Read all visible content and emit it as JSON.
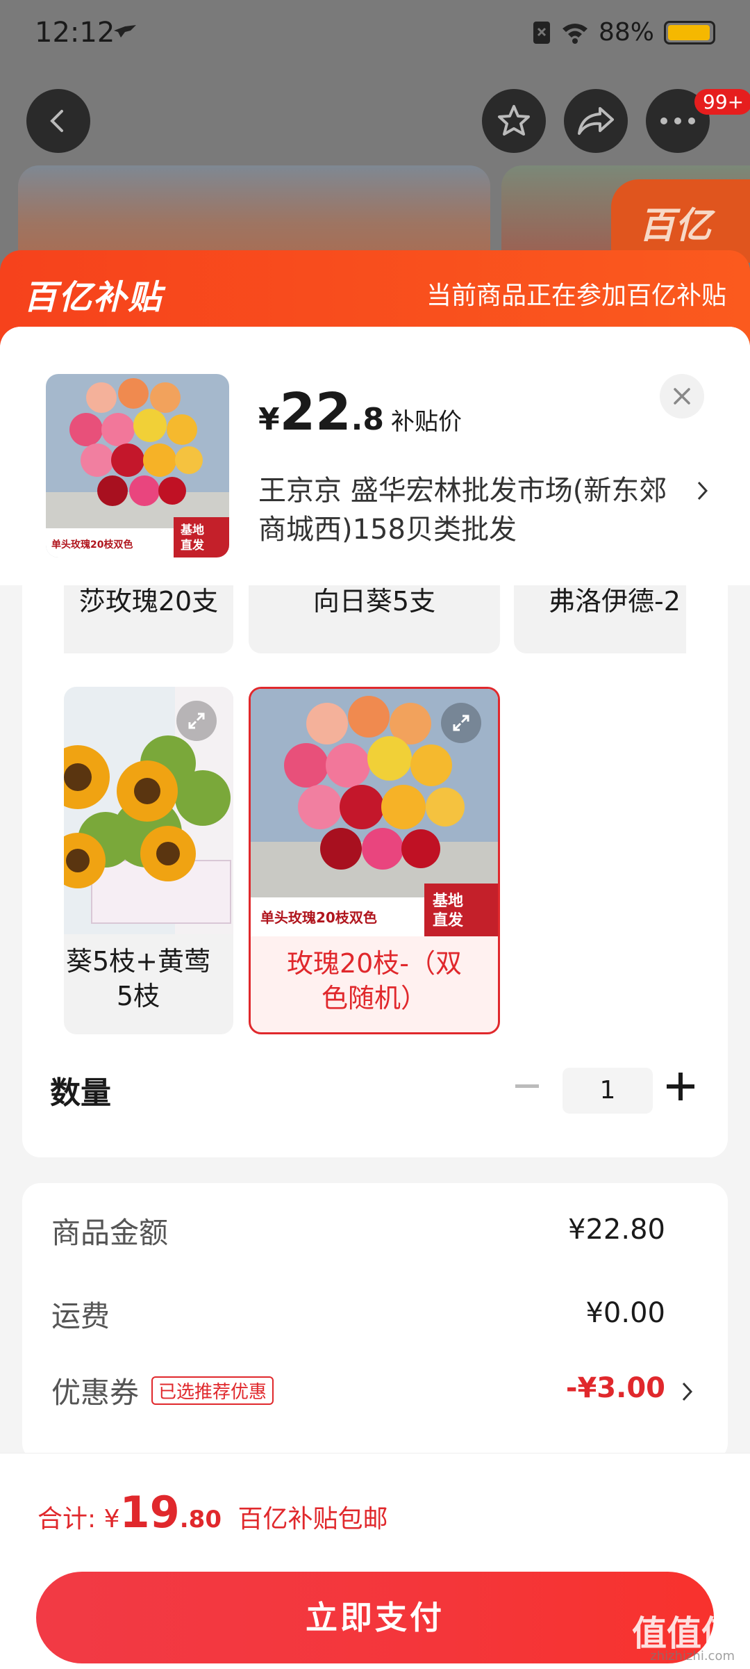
{
  "status_bar": {
    "time": "12:12",
    "battery": "88%"
  },
  "top_bar": {
    "badge": "99+"
  },
  "background_badge": "百亿",
  "banner": {
    "logo": "百亿补贴",
    "text": "当前商品正在参加百亿补贴"
  },
  "product": {
    "currency": "¥",
    "price_int": "22",
    "price_dec": ".8",
    "price_label": "补贴价",
    "shop": "王京京  盛华宏林批发市场(新东郊商城西)158贝类批发",
    "thumb_text_1": "单头玫瑰20枝双色",
    "thumb_text_2": "基地直发"
  },
  "options": {
    "row1": [
      "莎玫瑰20支",
      "向日葵5支",
      "弗洛伊德-2"
    ],
    "sunflower_label": "葵5枝+黄莺5枝",
    "selected_label": "玫瑰20枝-（双色随机）",
    "selected_caption": "单头玫瑰20枝双色",
    "selected_badge": "基地直发"
  },
  "quantity": {
    "label": "数量",
    "value": "1"
  },
  "summary": {
    "goods_label": "商品金额",
    "goods_value": "¥22.80",
    "shipping_label": "运费",
    "shipping_value": "¥0.00",
    "coupon_label": "优惠券",
    "coupon_tag": "已选推荐优惠",
    "coupon_value": "-¥3.00"
  },
  "footer": {
    "total_prefix": "合计: ¥",
    "total_int": "19",
    "total_dec": ".80",
    "total_suffix": "百亿补贴包邮",
    "pay_label": "立即支付"
  },
  "watermark": {
    "main": "值值值",
    "sub": "zhizhizhi.com"
  }
}
